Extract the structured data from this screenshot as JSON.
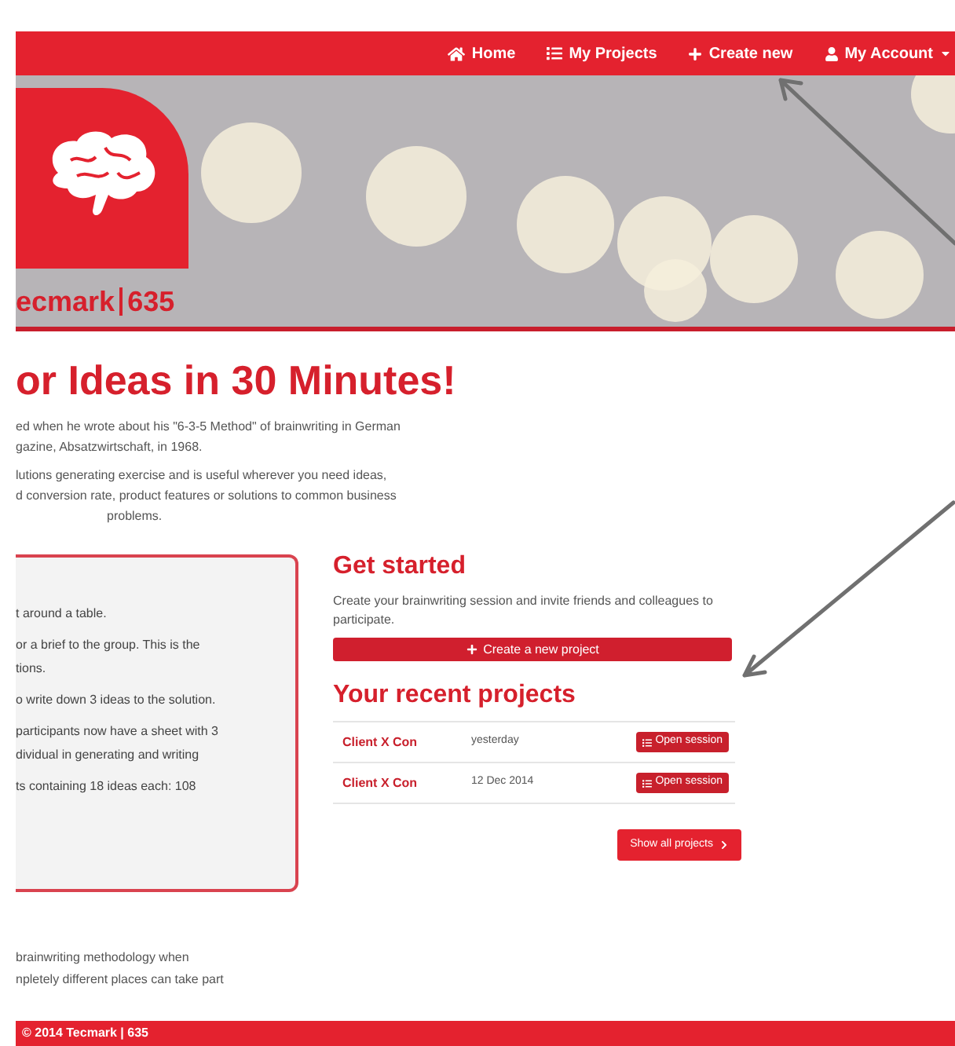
{
  "navbar": {
    "items": [
      {
        "label": "Home"
      },
      {
        "label": "My Projects"
      },
      {
        "label": "Create new"
      },
      {
        "label": "My Account"
      }
    ]
  },
  "hero": {
    "logo_text": "ecmark",
    "logo_number": "635"
  },
  "headline": "or Ideas in 30 Minutes!",
  "intro": [
    "ed when he wrote about his \"6-3-5 Method\" of brainwriting in German",
    "gazine, Absatzwirtschaft, in 1968."
  ],
  "intro2": [
    "lutions generating exercise and is useful wherever you need ideas,",
    "d conversion rate, product features or solutions to common business",
    "problems."
  ],
  "steps_box": {
    "paragraphs": [
      [
        "t around a table."
      ],
      [
        "or a brief to the group. This is the",
        "tions."
      ],
      [
        "o write down 3 ideas to the solution."
      ],
      [
        "participants now have a sheet with 3",
        "dividual in generating and writing"
      ],
      [
        "ts containing 18 ideas each: 108"
      ]
    ]
  },
  "get_started": {
    "title": "Get started",
    "text": "Create your brainwriting session and invite friends and colleagues to participate.",
    "button": "Create a new project"
  },
  "recent": {
    "title": "Your recent projects",
    "rows": [
      {
        "name": "Client X Con",
        "date": "yesterday",
        "action": "Open session"
      },
      {
        "name": "Client X Con",
        "date": "12 Dec 2014",
        "action": "Open session"
      }
    ],
    "show_all": "Show all projects"
  },
  "bottom_text": [
    "brainwriting methodology when",
    "npletely different places can take part"
  ],
  "footer": "© 2014 Tecmark | 635"
}
